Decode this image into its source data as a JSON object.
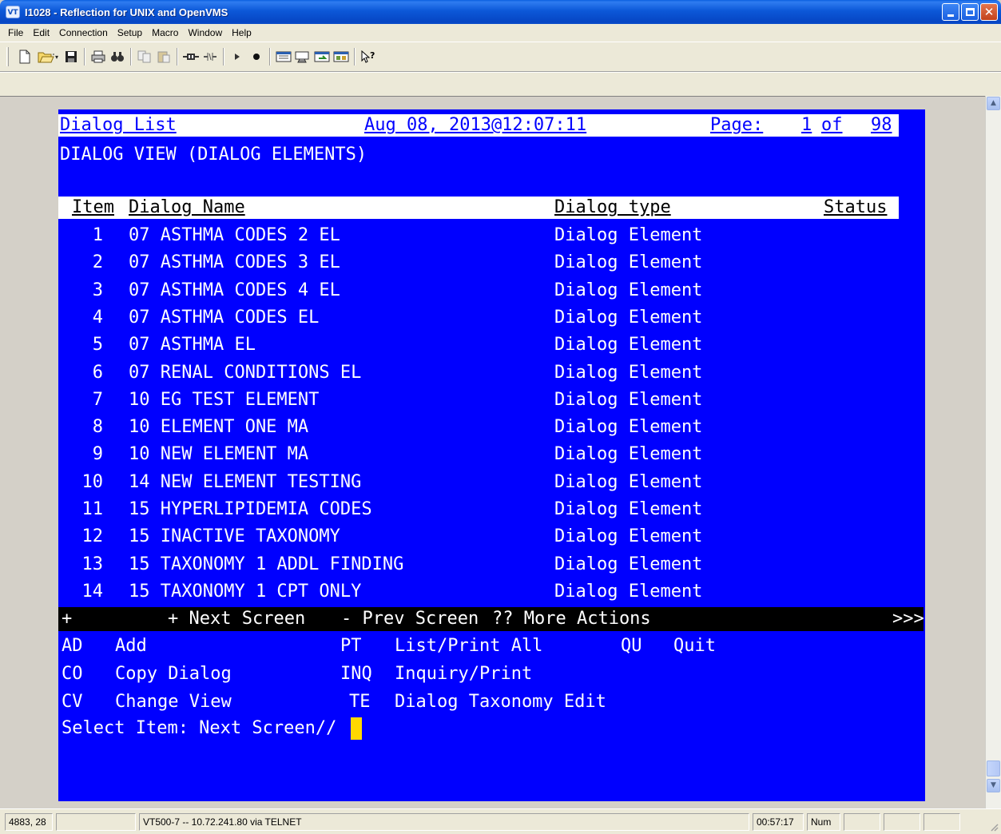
{
  "window": {
    "app_icon_label": "VT",
    "title": "I1028 - Reflection for UNIX and OpenVMS"
  },
  "menu": [
    "File",
    "Edit",
    "Connection",
    "Setup",
    "Macro",
    "Window",
    "Help"
  ],
  "toolbar_icons": [
    "new-document-icon",
    "open-folder-icon",
    "save-icon",
    "print-icon",
    "find-icon",
    "copy-icon",
    "paste-icon",
    "connect-icon",
    "disconnect-icon",
    "play-macro-icon",
    "record-macro-icon",
    "setup-icon",
    "send-icon",
    "transfer-icon",
    "keyboard-map-icon",
    "context-help-icon"
  ],
  "terminal": {
    "header": {
      "title": "Dialog List",
      "timestamp": "Aug 08, 2013@12:07:11",
      "page_label": "Page:",
      "page_current": "1",
      "page_of": "of",
      "page_total": "98"
    },
    "view_caption": "DIALOG VIEW (DIALOG ELEMENTS)",
    "columns": {
      "item": "Item",
      "name": "Dialog Name",
      "type": "Dialog type",
      "status": "Status"
    },
    "rows": [
      {
        "item": "1",
        "name": "07 ASTHMA CODES 2 EL",
        "type": "Dialog Element"
      },
      {
        "item": "2",
        "name": "07 ASTHMA CODES 3 EL",
        "type": "Dialog Element"
      },
      {
        "item": "3",
        "name": "07 ASTHMA CODES 4 EL",
        "type": "Dialog Element"
      },
      {
        "item": "4",
        "name": "07 ASTHMA CODES EL",
        "type": "Dialog Element"
      },
      {
        "item": "5",
        "name": "07 ASTHMA EL",
        "type": "Dialog Element"
      },
      {
        "item": "6",
        "name": "07 RENAL CONDITIONS EL",
        "type": "Dialog Element"
      },
      {
        "item": "7",
        "name": "10 EG TEST ELEMENT",
        "type": "Dialog Element"
      },
      {
        "item": "8",
        "name": "10 ELEMENT ONE MA",
        "type": "Dialog Element"
      },
      {
        "item": "9",
        "name": "10 NEW ELEMENT MA",
        "type": "Dialog Element"
      },
      {
        "item": "10",
        "name": "14 NEW ELEMENT TESTING",
        "type": "Dialog Element"
      },
      {
        "item": "11",
        "name": "15 HYPERLIPIDEMIA CODES",
        "type": "Dialog Element"
      },
      {
        "item": "12",
        "name": "15 INACTIVE TAXONOMY",
        "type": "Dialog Element"
      },
      {
        "item": "13",
        "name": "15 TAXONOMY 1 ADDL FINDING",
        "type": "Dialog Element"
      },
      {
        "item": "14",
        "name": "15 TAXONOMY 1 CPT ONLY",
        "type": "Dialog Element"
      }
    ],
    "action_bar": {
      "plus": "+",
      "next": "+ Next Screen",
      "prev": "- Prev Screen",
      "more": "?? More Actions",
      "arrows": ">>>"
    },
    "actions": [
      {
        "code": "AD",
        "label": "Add"
      },
      {
        "code": "CO",
        "label": "Copy Dialog"
      },
      {
        "code": "CV",
        "label": "Change View"
      },
      {
        "code": "PT",
        "label": "List/Print All"
      },
      {
        "code": "INQ",
        "label": "Inquiry/Print"
      },
      {
        "code": "TE",
        "label": "Dialog Taxonomy Edit"
      },
      {
        "code": "QU",
        "label": "Quit"
      }
    ],
    "prompt": "Select Item: Next Screen// "
  },
  "status_bar": {
    "cursor_pos": "4883, 28",
    "connection": "VT500-7 -- 10.72.241.80 via TELNET",
    "elapsed": "00:57:17",
    "num": "Num"
  },
  "colors": {
    "terminal_bg": "#0000ff",
    "terminal_fg": "#ffffff",
    "cursor": "#ffd800",
    "titlebar": "#0a4cc8"
  }
}
